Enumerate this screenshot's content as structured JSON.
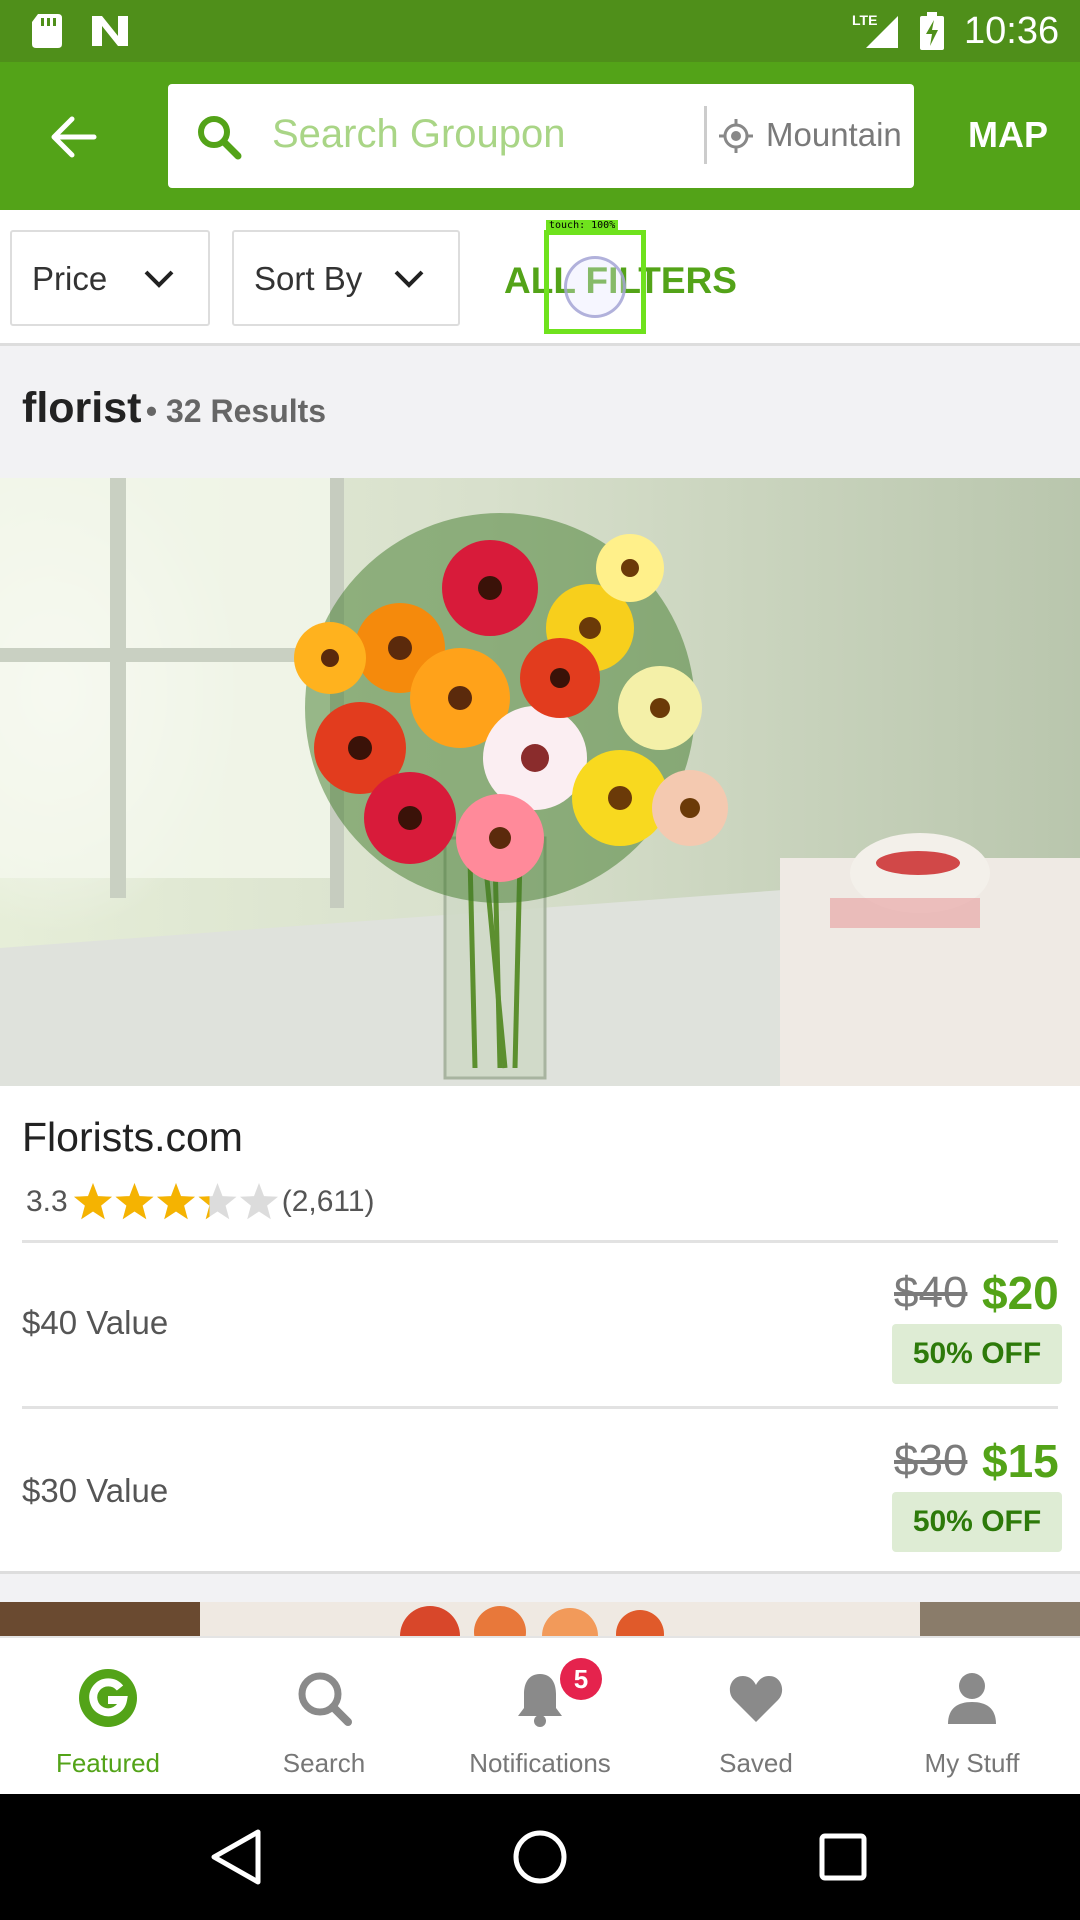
{
  "status_bar": {
    "network": "LTE",
    "time": "10:36"
  },
  "header": {
    "search_placeholder": "Search Groupon",
    "location": "Mountain",
    "map_label": "MAP"
  },
  "filters": {
    "price_label": "Price",
    "sort_label": "Sort By",
    "all_filters_label": "ALL FILTERS",
    "touch_overlay_label": "touch: 100%"
  },
  "results": {
    "query": "florist",
    "count_text": "• 32 Results"
  },
  "deal": {
    "title": "Florists.com",
    "rating": "3.3",
    "rating_value": 3.3,
    "rating_max": 5,
    "review_count": "(2,611)",
    "options": [
      {
        "label": "$40 Value",
        "original": "$40",
        "price": "$20",
        "discount": "50% OFF"
      },
      {
        "label": "$30 Value",
        "original": "$30",
        "price": "$15",
        "discount": "50% OFF"
      }
    ]
  },
  "bottom_nav": {
    "items": [
      {
        "label": "Featured",
        "icon": "groupon-g-icon",
        "active": true
      },
      {
        "label": "Search",
        "icon": "search-icon"
      },
      {
        "label": "Notifications",
        "icon": "bell-icon",
        "badge": "5"
      },
      {
        "label": "Saved",
        "icon": "heart-icon"
      },
      {
        "label": "My Stuff",
        "icon": "person-icon"
      }
    ]
  },
  "colors": {
    "brand_green": "#53a318",
    "status_green": "#4f8f1a",
    "badge_red": "#e5234d",
    "star_gold": "#f5b301"
  }
}
